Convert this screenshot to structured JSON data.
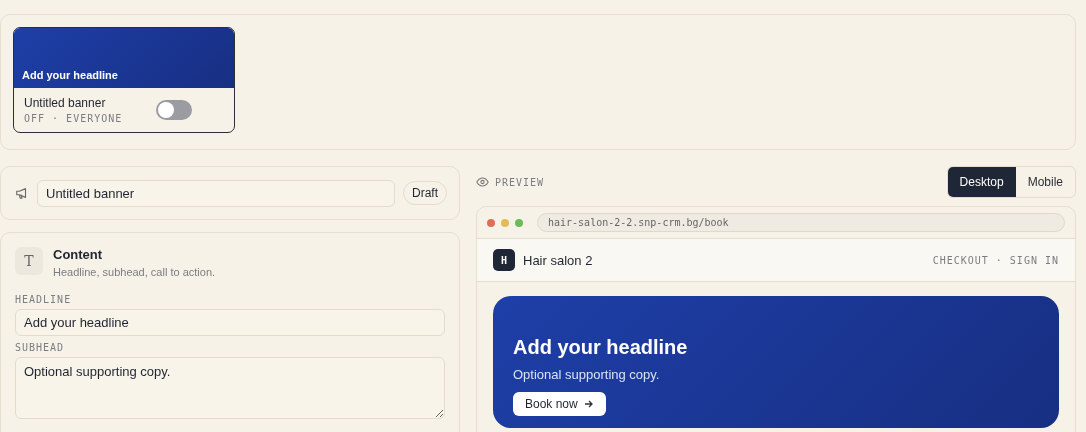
{
  "top_card": {
    "headline": "Add your headline",
    "title": "Untitled banner",
    "status": "OFF · EVERYONE",
    "on": false
  },
  "editor": {
    "name_field": {
      "value": "Untitled banner"
    },
    "badge": "Draft"
  },
  "content_section": {
    "icon": "T",
    "title": "Content",
    "description": "Headline, subhead, call to action.",
    "fields": [
      {
        "label": "HEADLINE",
        "kind": "input",
        "value": "Add your headline"
      },
      {
        "label": "SUBHEAD",
        "kind": "textarea",
        "value": "Optional supporting copy."
      }
    ]
  },
  "preview": {
    "label": "PREVIEW",
    "modes": [
      {
        "label": "Desktop",
        "selected": true
      },
      {
        "label": "Mobile",
        "selected": false
      }
    ],
    "url": "hair-salon-2-2.snp-crm.bg/book",
    "site": {
      "logo": "H",
      "name": "Hair salon 2",
      "nav": "CHECKOUT · SIGN IN"
    },
    "banner": {
      "headline": "Add your headline",
      "subhead": "Optional supporting copy.",
      "button": "Book now"
    }
  }
}
